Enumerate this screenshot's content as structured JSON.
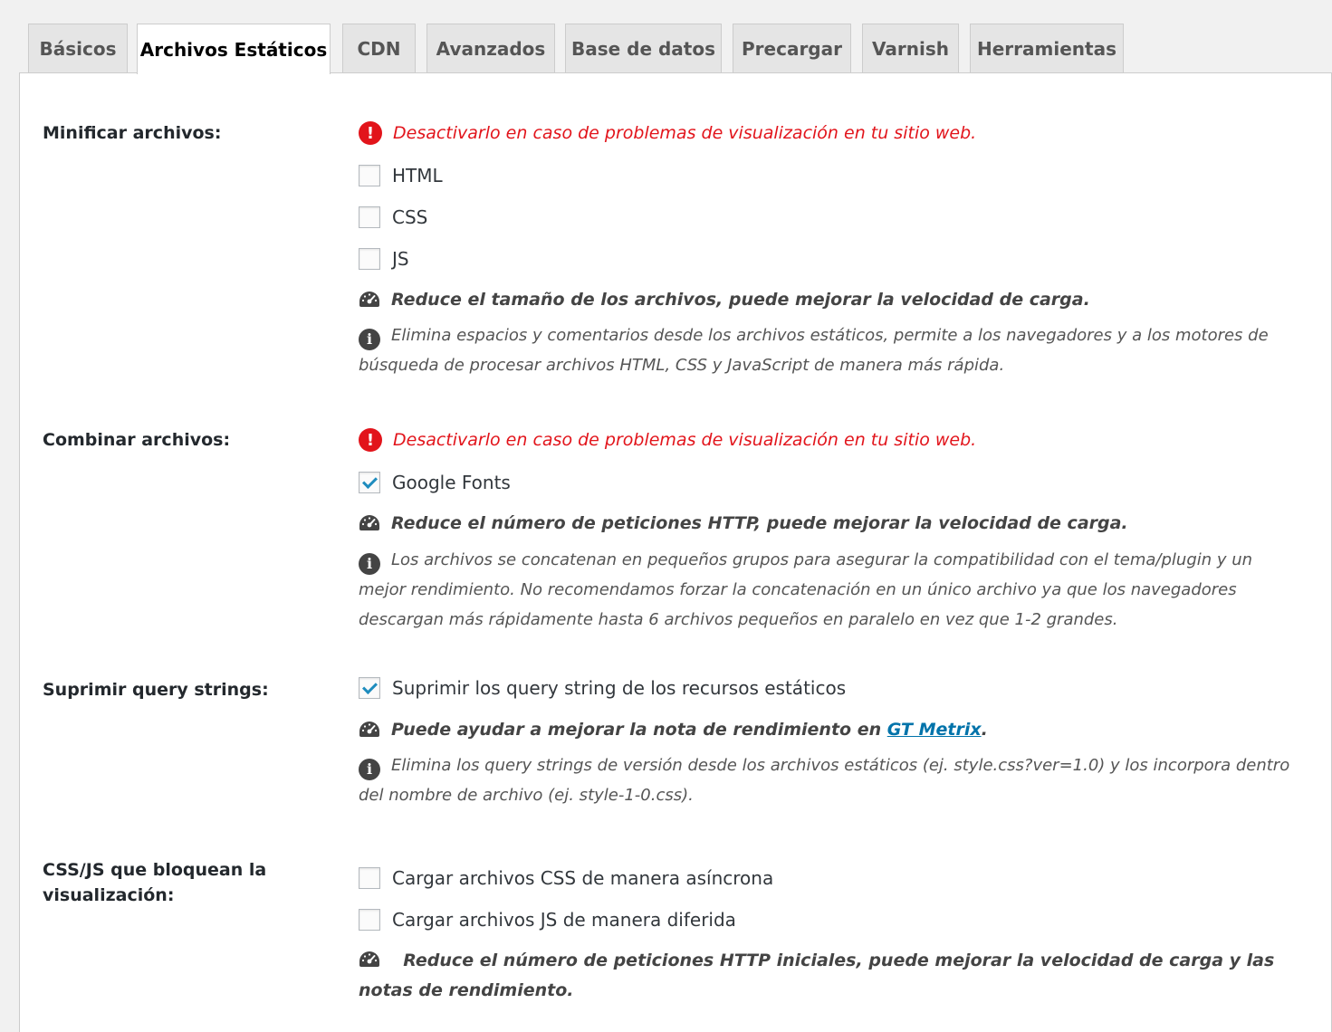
{
  "tabs": [
    {
      "label": "Básicos",
      "active": false
    },
    {
      "label": "Archivos Estáticos",
      "active": true
    },
    {
      "label": "CDN",
      "active": false
    },
    {
      "label": "Avanzados",
      "active": false
    },
    {
      "label": "Base de datos",
      "active": false
    },
    {
      "label": "Precargar",
      "active": false
    },
    {
      "label": "Varnish",
      "active": false
    },
    {
      "label": "Herramientas",
      "active": false
    }
  ],
  "minify": {
    "label": "Minificar archivos:",
    "warning": "Desactivarlo en caso de problemas de visualización en tu sitio web.",
    "options": [
      {
        "label": "HTML",
        "checked": false
      },
      {
        "label": "CSS",
        "checked": false
      },
      {
        "label": "JS",
        "checked": false
      }
    ],
    "benefit": "Reduce el tamaño de los archivos, puede mejorar la velocidad de carga.",
    "info": "Elimina espacios y comentarios desde los archivos estáticos, permite a los navegadores y a los motores de búsqueda de procesar archivos HTML, CSS y JavaScript de manera más rápida."
  },
  "combine": {
    "label": "Combinar archivos:",
    "warning": "Desactivarlo en caso de problemas de visualización en tu sitio web.",
    "options": [
      {
        "label": "Google Fonts",
        "checked": true
      }
    ],
    "benefit": "Reduce el número de peticiones HTTP, puede mejorar la velocidad de carga.",
    "info": "Los archivos se concatenan en pequeños grupos para asegurar la compatibilidad con el tema/plugin y un mejor rendimiento. No recomendamos forzar la concatenación en un único archivo ya que los navegadores descargan más rápidamente hasta 6 archivos pequeños en paralelo en vez que 1-2 grandes."
  },
  "query": {
    "label": "Suprimir query strings:",
    "options": [
      {
        "label": "Suprimir los query string de los recursos estáticos",
        "checked": true
      }
    ],
    "benefit_prefix": "Puede ayudar a mejorar la nota de rendimiento en ",
    "benefit_link": "GT Metrix",
    "benefit_suffix": ".",
    "info": "Elimina los query strings de versión desde los archivos estáticos (ej. style.css?ver=1.0) y los incorpora dentro del nombre de archivo (ej. style-1-0.css)."
  },
  "blocking": {
    "label": "CSS/JS que bloquean la visualización:",
    "options": [
      {
        "label": "Cargar archivos CSS de manera asíncrona",
        "checked": false
      },
      {
        "label": "Cargar archivos JS de manera diferida",
        "checked": false
      }
    ],
    "benefit": "Reduce el número de peticiones HTTP iniciales, puede mejorar la velocidad de carga y las notas de rendimiento."
  },
  "icons": {
    "warning": "exclamation-circle-icon",
    "gauge": "dashboard-gauge-icon",
    "info": "info-circle-icon",
    "checkmark": "checkmark-icon"
  },
  "colors": {
    "warning": "#e2141b",
    "link": "#0073aa",
    "check": "#1e8cbe"
  }
}
